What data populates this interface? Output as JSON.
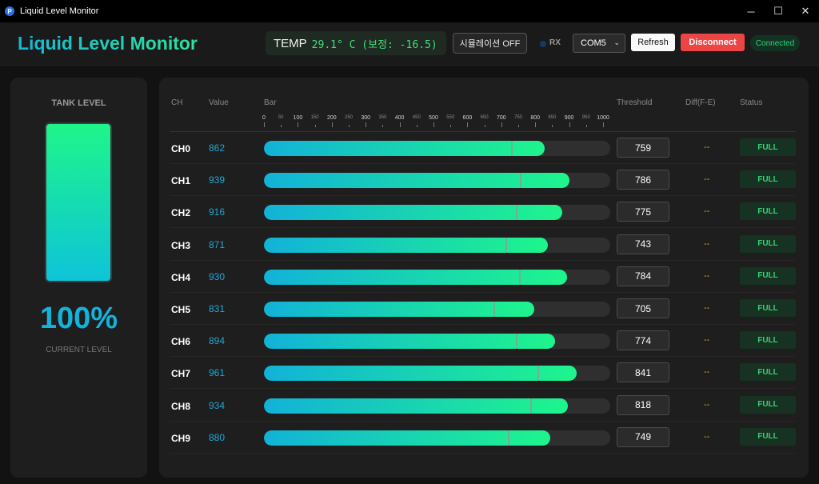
{
  "window": {
    "title": "Liquid Level Monitor",
    "icon_letter": "P",
    "minimize_glyph": "─",
    "maximize_glyph": "☐",
    "close_glyph": "✕"
  },
  "header": {
    "title": "Liquid Level Monitor",
    "temp_label": "TEMP",
    "temp_value": "29.1° C (보정: -16.5)",
    "sim_button": "시뮬레이션 OFF",
    "rx_label": "RX",
    "port": "COM5",
    "caret": "⌄",
    "refresh": "Refresh",
    "disconnect": "Disconnect",
    "status": "Connected"
  },
  "tank": {
    "title": "TANK LEVEL",
    "level_fraction": 1.0,
    "percent_text": "100%",
    "subtitle": "CURRENT LEVEL"
  },
  "table": {
    "columns": {
      "ch": "CH",
      "value": "Value",
      "bar": "Bar",
      "threshold": "Threshold",
      "diff": "Diff(F-E)",
      "status": "Status"
    },
    "scale": [
      "0",
      "50",
      "100",
      "150",
      "200",
      "250",
      "300",
      "350",
      "400",
      "450",
      "500",
      "550",
      "600",
      "650",
      "700",
      "750",
      "800",
      "850",
      "900",
      "950",
      "1000"
    ],
    "scale_max": 1000,
    "channels": [
      {
        "name": "CH0",
        "value": "862",
        "threshold": "759",
        "diff": "--",
        "status": "FULL"
      },
      {
        "name": "CH1",
        "value": "939",
        "threshold": "786",
        "diff": "--",
        "status": "FULL"
      },
      {
        "name": "CH2",
        "value": "916",
        "threshold": "775",
        "diff": "--",
        "status": "FULL"
      },
      {
        "name": "CH3",
        "value": "871",
        "threshold": "743",
        "diff": "--",
        "status": "FULL"
      },
      {
        "name": "CH4",
        "value": "930",
        "threshold": "784",
        "diff": "--",
        "status": "FULL"
      },
      {
        "name": "CH5",
        "value": "831",
        "threshold": "705",
        "diff": "--",
        "status": "FULL"
      },
      {
        "name": "CH6",
        "value": "894",
        "threshold": "774",
        "diff": "--",
        "status": "FULL"
      },
      {
        "name": "CH7",
        "value": "961",
        "threshold": "841",
        "diff": "--",
        "status": "FULL"
      },
      {
        "name": "CH8",
        "value": "934",
        "threshold": "818",
        "diff": "--",
        "status": "FULL"
      },
      {
        "name": "CH9",
        "value": "880",
        "threshold": "749",
        "diff": "--",
        "status": "FULL"
      }
    ]
  }
}
